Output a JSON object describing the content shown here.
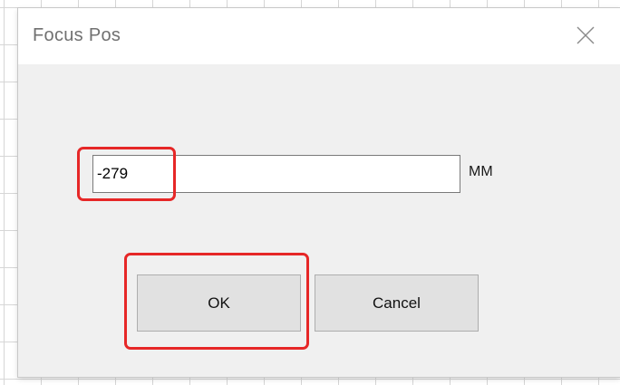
{
  "dialog": {
    "title": "Focus Pos",
    "close_icon": "close-icon"
  },
  "focus_field": {
    "value": "-279",
    "unit": "MM"
  },
  "buttons": {
    "ok_label": "OK",
    "cancel_label": "Cancel"
  },
  "colors": {
    "highlight": "#e62727",
    "dialog_background": "#f0f0f0",
    "button_background": "#e1e1e1"
  }
}
